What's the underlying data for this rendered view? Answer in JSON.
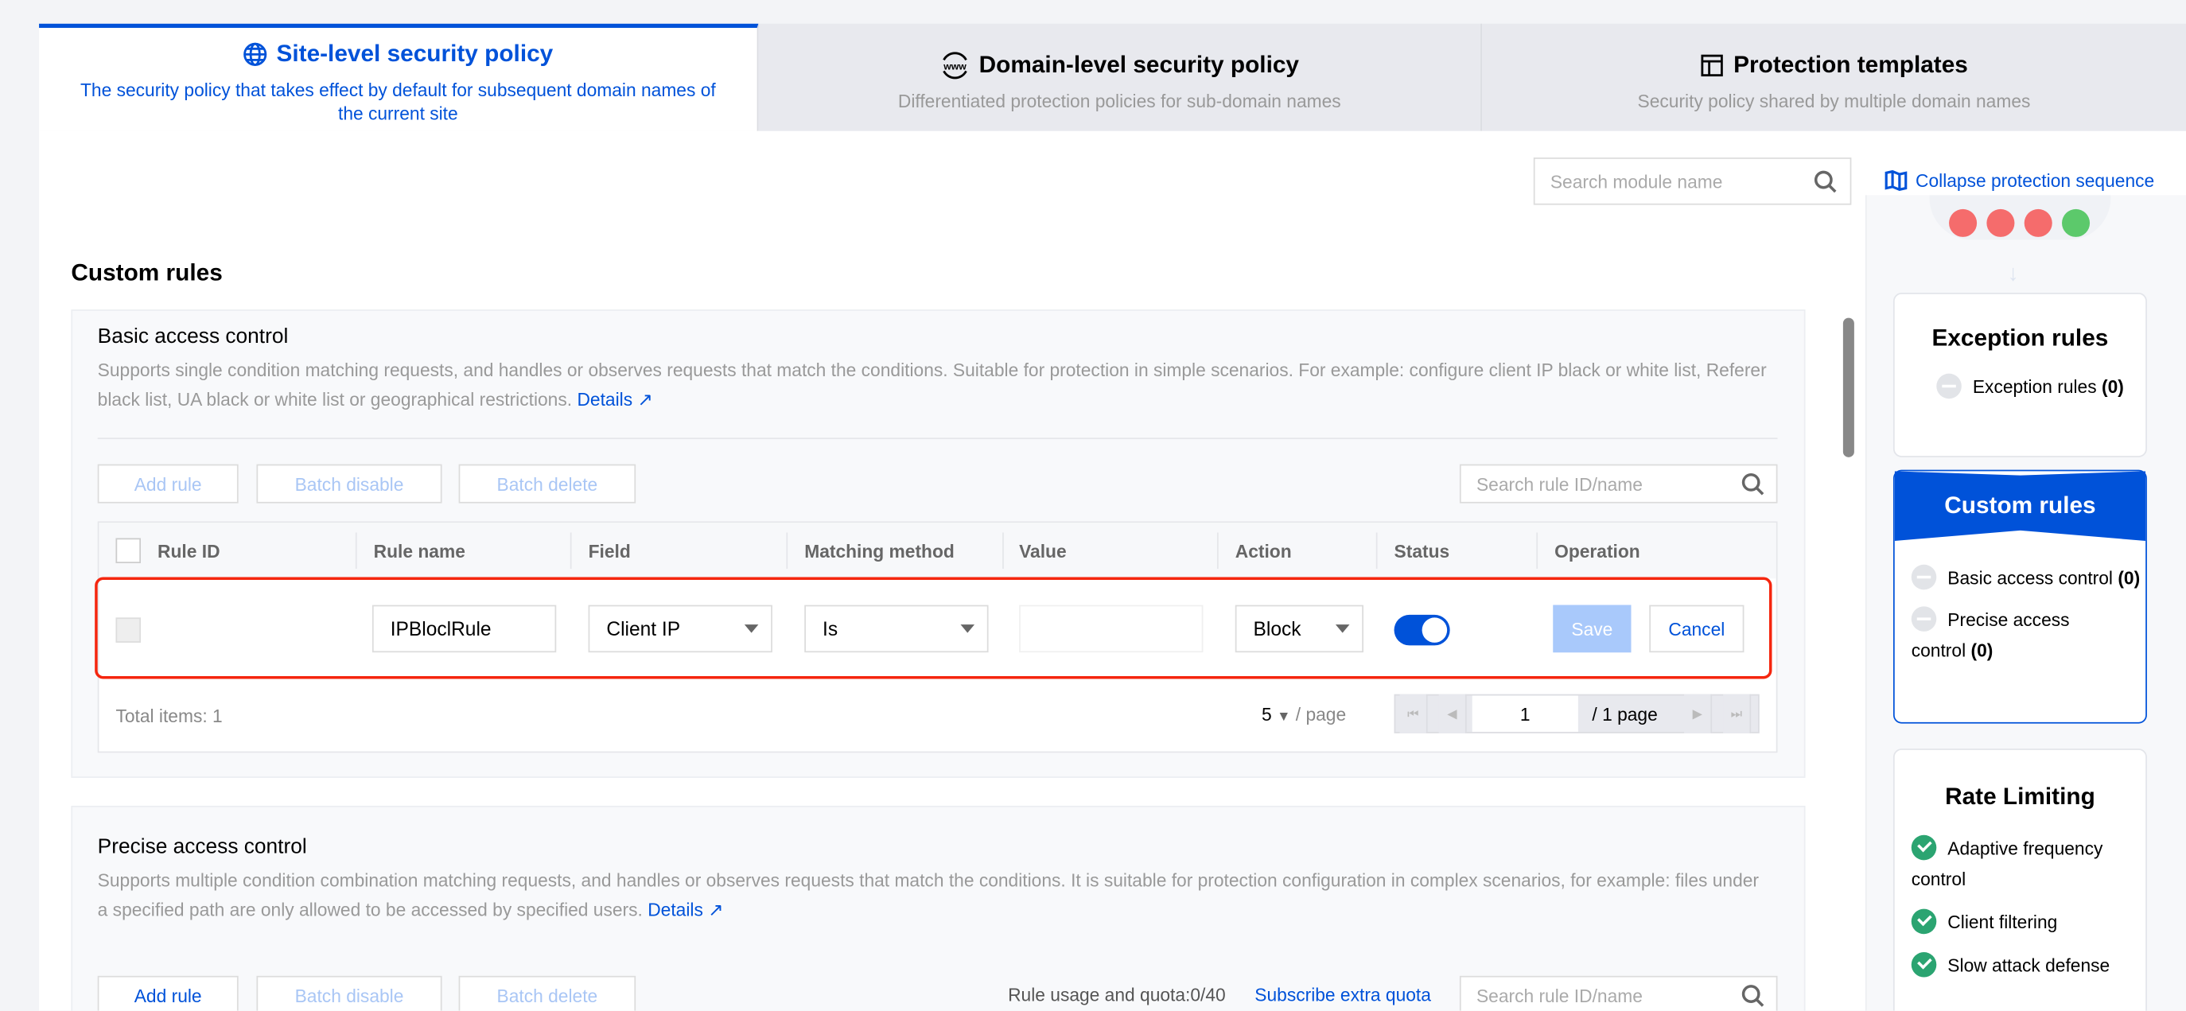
{
  "tabs": [
    {
      "title": "Site-level security policy",
      "subtitle": "The security policy that takes effect by default for subsequent domain names of the current site",
      "icon": "globe-icon",
      "active": true
    },
    {
      "title": "Domain-level security policy",
      "subtitle": "Differentiated protection policies for sub-domain names",
      "icon": "www-icon"
    },
    {
      "title": "Protection templates",
      "subtitle": "Security policy shared by multiple domain names",
      "icon": "template-icon"
    }
  ],
  "toolbar": {
    "search_placeholder": "Search module name",
    "collapse_label": "Collapse protection sequence"
  },
  "section_title": "Custom rules",
  "basic": {
    "title": "Basic access control",
    "description": "Supports single condition matching requests, and handles or observes requests that match the conditions. Suitable for protection in simple scenarios. For example: configure client IP black or white list, Referer black list, UA black or white list or geographical restrictions.",
    "details": "Details",
    "add_rule": "Add rule",
    "batch_disable": "Batch disable",
    "batch_delete": "Batch delete",
    "search_placeholder": "Search rule ID/name",
    "columns": [
      "Rule ID",
      "Rule name",
      "Field",
      "Matching method",
      "Value",
      "Action",
      "Status",
      "Operation"
    ],
    "edit_row": {
      "rule_name": "IPBloclRule",
      "field": "Client IP",
      "matching": "Is",
      "value": "",
      "action": "Block",
      "status_on": true,
      "save": "Save",
      "cancel": "Cancel"
    },
    "footer": {
      "total": "Total items:  1",
      "page_size": "5",
      "per_page": "/ page",
      "page": "1",
      "page_total": "/ 1 page"
    }
  },
  "precise": {
    "title": "Precise access control",
    "description": "Supports multiple condition combination matching requests, and handles or observes requests that match the conditions. It is suitable for protection configuration in complex scenarios, for example: files under a specified path are only allowed to be accessed by specified users.",
    "details": "Details",
    "add_rule": "Add rule",
    "batch_disable": "Batch disable",
    "batch_delete": "Batch delete",
    "quota": "Rule usage and quota:0/40",
    "subscribe": "Subscribe extra quota",
    "search_placeholder": "Search rule ID/name"
  },
  "sequence": {
    "exception": {
      "title": "Exception rules",
      "items": [
        {
          "label": "Exception rules",
          "count": "(0)",
          "state": "off"
        }
      ]
    },
    "custom": {
      "title": "Custom rules",
      "items": [
        {
          "label": "Basic access control",
          "count": "(0)",
          "state": "off"
        },
        {
          "label": "Precise access control",
          "count": "(0)",
          "state": "off"
        }
      ]
    },
    "rate": {
      "title": "Rate Limiting",
      "items": [
        {
          "label": "Adaptive frequency control",
          "state": "on"
        },
        {
          "label": "Client filtering",
          "state": "on"
        },
        {
          "label": "Slow attack defense",
          "state": "on"
        }
      ]
    }
  },
  "colors": {
    "accent": "#0052d9",
    "highlight": "#f5260f",
    "enabled": "#2ba471"
  }
}
